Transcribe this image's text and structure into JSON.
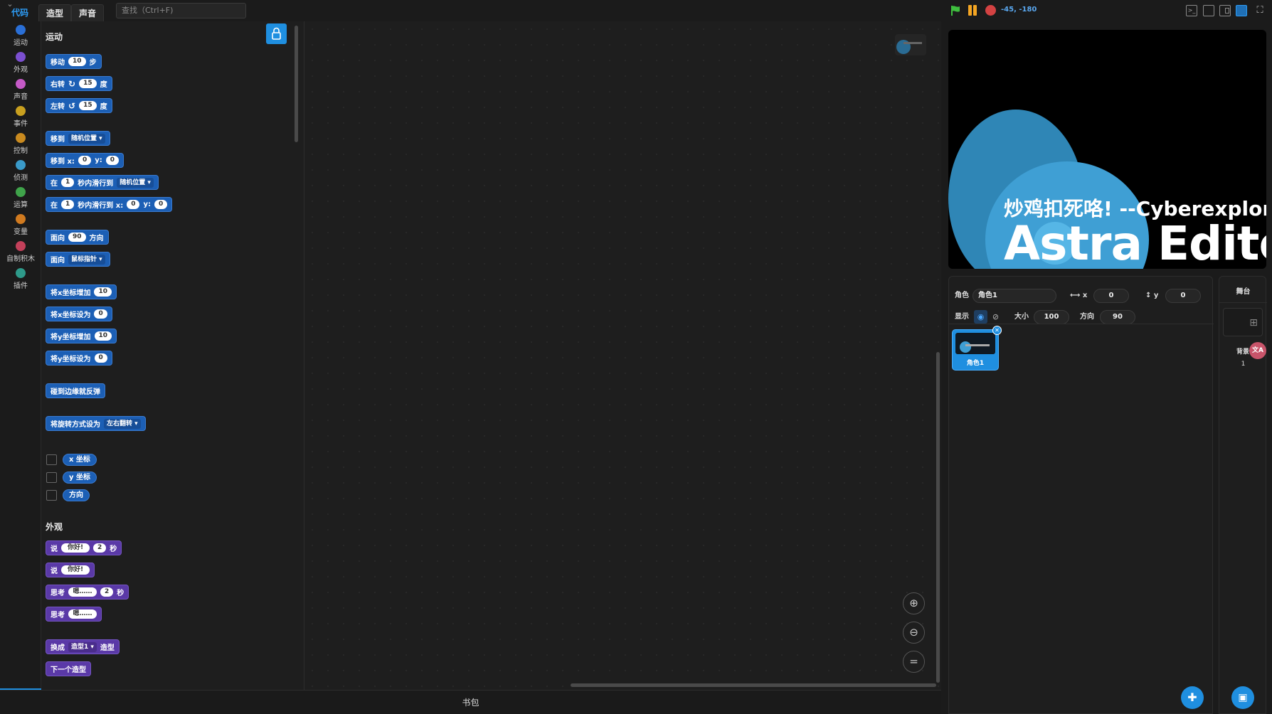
{
  "tabs": {
    "code": "代码",
    "costumes": "造型",
    "sounds": "声音"
  },
  "search": {
    "placeholder": "查找（Ctrl+F)"
  },
  "categories": [
    {
      "label": "运动",
      "color": "#2a6fd6"
    },
    {
      "label": "外观",
      "color": "#7b4fd0"
    },
    {
      "label": "声音",
      "color": "#c55ac7"
    },
    {
      "label": "事件",
      "color": "#c9a01f"
    },
    {
      "label": "控制",
      "color": "#c98a1f"
    },
    {
      "label": "侦测",
      "color": "#3a9ac9"
    },
    {
      "label": "运算",
      "color": "#3fa34a"
    },
    {
      "label": "变量",
      "color": "#d07a1f"
    },
    {
      "label": "自制积木",
      "color": "#c3405a"
    },
    {
      "label": "插件",
      "color": "#2e9a8a"
    }
  ],
  "palette": {
    "motion_title": "运动",
    "looks_title": "外观",
    "move": {
      "prefix": "移动",
      "value": "10",
      "suffix": "步"
    },
    "turn_right": {
      "prefix": "右转",
      "value": "15",
      "suffix": "度"
    },
    "turn_left": {
      "prefix": "左转",
      "value": "15",
      "suffix": "度"
    },
    "goto": {
      "prefix": "移到",
      "option": "随机位置"
    },
    "goto_xy": {
      "prefix": "移到 x:",
      "x": "0",
      "ylabel": "y:",
      "y": "0"
    },
    "glide_to": {
      "prefix": "在",
      "secs": "1",
      "mid": "秒内滑行到",
      "option": "随机位置"
    },
    "glide_xy": {
      "prefix": "在",
      "secs": "1",
      "mid": "秒内滑行到 x:",
      "x": "0",
      "ylabel": "y:",
      "y": "0"
    },
    "point_dir": {
      "prefix": "面向",
      "value": "90",
      "suffix": "方向"
    },
    "point_towards": {
      "prefix": "面向",
      "option": "鼠标指针"
    },
    "change_x": {
      "prefix": "将x坐标增加",
      "value": "10"
    },
    "set_x": {
      "prefix": "将x坐标设为",
      "value": "0"
    },
    "change_y": {
      "prefix": "将y坐标增加",
      "value": "10"
    },
    "set_y": {
      "prefix": "将y坐标设为",
      "value": "0"
    },
    "bounce": "碰到边缘就反弹",
    "rotation_style": {
      "prefix": "将旋转方式设为",
      "option": "左右翻转"
    },
    "reporters": [
      "x 坐标",
      "y 坐标",
      "方向"
    ],
    "say_secs": {
      "prefix": "说",
      "text": "你好!",
      "secs": "2",
      "suffix": "秒"
    },
    "say": {
      "prefix": "说",
      "text": "你好!"
    },
    "think_secs": {
      "prefix": "思考",
      "text": "嗯……",
      "secs": "2",
      "suffix": "秒"
    },
    "think": {
      "prefix": "思考",
      "text": "嗯……"
    },
    "switch_costume": {
      "prefix": "换成",
      "option": "造型1",
      "suffix": "造型"
    },
    "next_costume": "下一个造型"
  },
  "backpack": "书包",
  "stage_header": {
    "coords": "-45, -180"
  },
  "stage": {
    "subtitle": "炒鸡扣死咯! --Cyberexplorer",
    "title": "Astra Editor"
  },
  "sprite_info": {
    "sprite_label": "角色",
    "sprite_name": "角色1",
    "x_label": "x",
    "x_value": "0",
    "y_label": "y",
    "y_value": "0",
    "show_label": "显示",
    "size_label": "大小",
    "size_value": "100",
    "direction_label": "方向",
    "direction_value": "90"
  },
  "sprites": [
    {
      "name": "角色1"
    }
  ],
  "stage_pane": {
    "title": "舞台",
    "backdrop_label": "背景",
    "backdrop_count": "1"
  },
  "colors": {
    "accent": "#1f8fe0",
    "motion": "#1c5fb5",
    "looks": "#5a39a7",
    "flag": "#3fbf3f",
    "pause": "#f5a623",
    "stop": "#d34242"
  }
}
